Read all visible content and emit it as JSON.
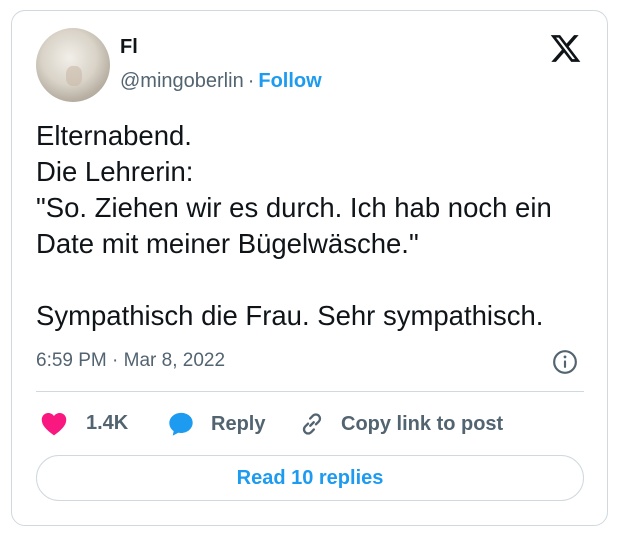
{
  "user": {
    "display_name": "Fl",
    "handle": "@mingoberlin",
    "separator": "·",
    "follow_label": "Follow"
  },
  "tweet": {
    "text": "Elternabend.\nDie Lehrerin:\n\"So. Ziehen wir es durch. Ich hab noch ein Date mit meiner Bügelwäsche.\"\n\nSympathisch die Frau. Sehr sympathisch.",
    "timestamp": "6:59 PM · Mar 8, 2022"
  },
  "actions": {
    "likes_count": "1.4K",
    "reply_label": "Reply",
    "copy_link_label": "Copy link to post"
  },
  "read_replies_label": "Read 10 replies",
  "icons": {
    "logo": "x-logo-icon",
    "info": "info-icon",
    "heart": "heart-icon",
    "reply": "speech-bubble-icon",
    "link": "link-icon"
  },
  "colors": {
    "accent": "#1d9bf0",
    "heart": "#f91880",
    "text": "#0f1419",
    "muted": "#536471",
    "border": "#cfd9de"
  }
}
